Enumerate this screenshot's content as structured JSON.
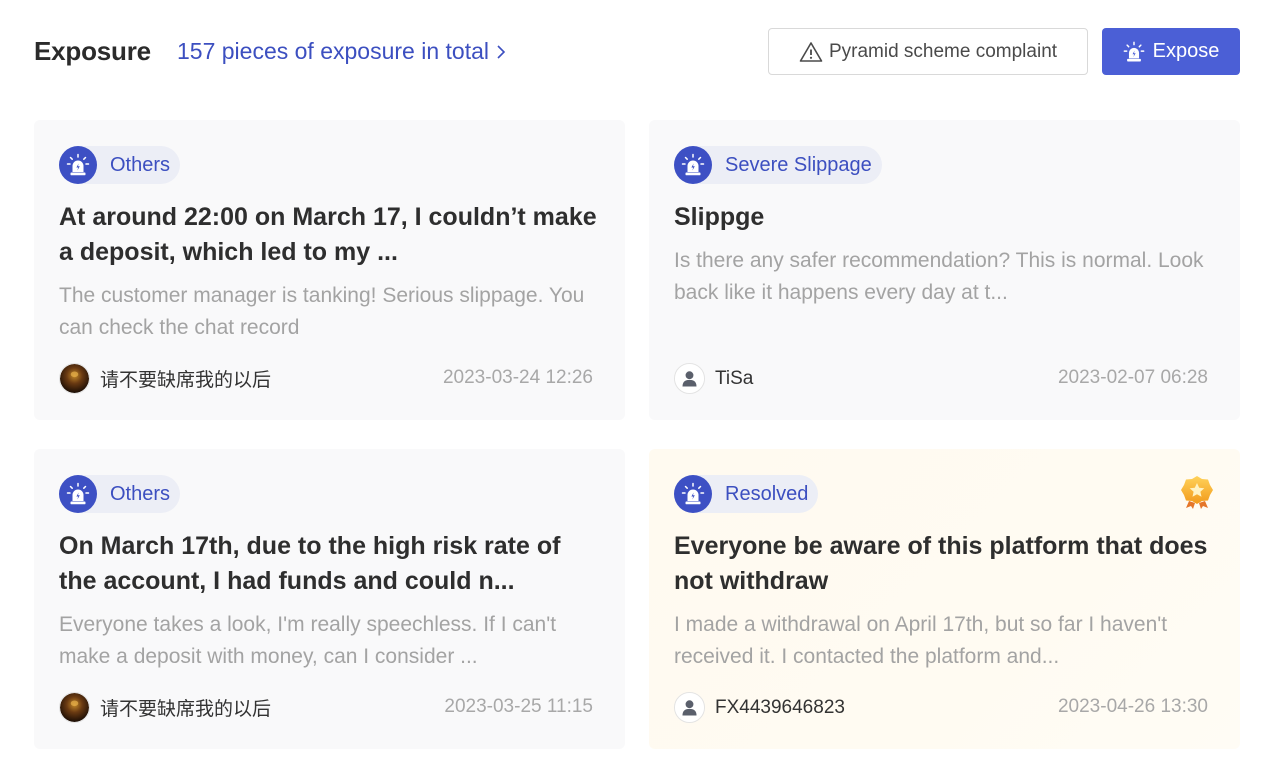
{
  "header": {
    "title": "Exposure",
    "total_link": "157 pieces of exposure in total",
    "complaint_button": "Pyramid scheme complaint",
    "expose_button": "Expose"
  },
  "colors": {
    "accent": "#4b5fd6",
    "tag_text": "#3c4fc0",
    "card_bg": "#f9f9fa",
    "resolved_card_bg": "#fffaf0"
  },
  "cards": [
    {
      "tag": "Others",
      "title": "At around 22:00 on March 17, I couldn’t make a deposit, which led to my ...",
      "description": "The customer manager is tanking! Serious slippage. You can check the chat record",
      "author": "请不要缺席我的以后",
      "avatar": "dark-photo-avatar",
      "date": "2023-03-24 12:26"
    },
    {
      "tag": "Severe Slippage",
      "title": "Slippge",
      "description": "Is there any safer recommendation? This is normal. Look back like it happens every day at t...",
      "author": "TiSa",
      "avatar": "default-user-avatar",
      "date": "2023-02-07 06:28"
    },
    {
      "tag": "Others",
      "title": "On March 17th, due to the high risk rate of the account, I had funds and could n...",
      "description": "Everyone takes a look, I'm really speechless. If I can't make a deposit with money, can I consider ...",
      "author": "请不要缺席我的以后",
      "avatar": "dark-photo-avatar",
      "date": "2023-03-25 11:15"
    },
    {
      "tag": "Resolved",
      "title": "Everyone be aware of this platform that does not withdraw",
      "description": "I made a withdrawal on April 17th, but so far I haven't received it. I contacted the platform and...",
      "author": "FX4439646823",
      "avatar": "default-user-avatar",
      "date": "2023-04-26 13:30",
      "badge": "gold-star-badge-icon"
    }
  ]
}
